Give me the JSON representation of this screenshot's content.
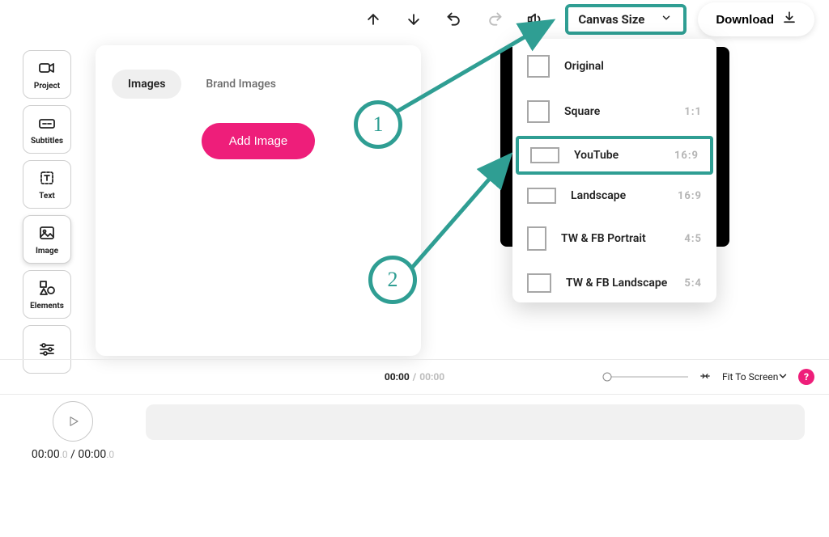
{
  "toolbar": {
    "canvas_size_label": "Canvas Size",
    "download_label": "Download"
  },
  "sidebar": {
    "items": [
      {
        "label": "Project"
      },
      {
        "label": "Subtitles"
      },
      {
        "label": "Text"
      },
      {
        "label": "Image"
      },
      {
        "label": "Elements"
      }
    ]
  },
  "panel": {
    "tab_images": "Images",
    "tab_brand_images": "Brand Images",
    "add_image_label": "Add Image"
  },
  "canvas_dropdown": {
    "items": [
      {
        "label": "Original",
        "ratio": ""
      },
      {
        "label": "Square",
        "ratio": "1:1"
      },
      {
        "label": "YouTube",
        "ratio": "16:9"
      },
      {
        "label": "Landscape",
        "ratio": "16:9"
      },
      {
        "label": "TW & FB Portrait",
        "ratio": "4:5"
      },
      {
        "label": "TW & FB Landscape",
        "ratio": "5:4"
      }
    ]
  },
  "callouts": {
    "one": "1",
    "two": "2"
  },
  "time_row": {
    "current": "00:00",
    "total": "00:00",
    "fit_label": "Fit To Screen",
    "help": "?"
  },
  "playback": {
    "current": "00:00",
    "current_frac": ".0",
    "sep": " / ",
    "total": "00:00",
    "total_frac": ".0"
  },
  "colors": {
    "accent_teal": "#2f9e93",
    "accent_pink": "#ee1e7a"
  }
}
